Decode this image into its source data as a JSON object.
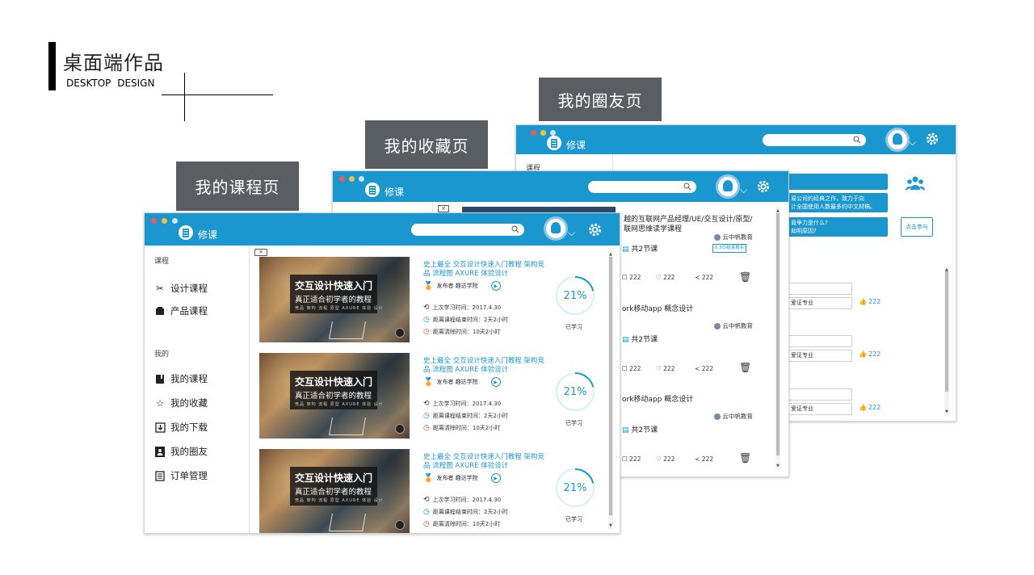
{
  "header": {
    "title": "桌面端作品",
    "subtitle": "DESKTOP  DESIGN"
  },
  "labels": {
    "circle": "我的圈友页",
    "fav": "我的收藏页",
    "course": "我的课程页"
  },
  "app": {
    "brand": "修课"
  },
  "sidebar": {
    "section_course": "课程",
    "items_course": [
      {
        "label": "设计课程",
        "icon": "scissors-icon"
      },
      {
        "label": "产品课程",
        "icon": "box-icon"
      }
    ],
    "section_mine": "我的",
    "items_mine": [
      {
        "label": "我的课程",
        "icon": "book-icon"
      },
      {
        "label": "我的收藏",
        "icon": "star-icon"
      },
      {
        "label": "我的下载",
        "icon": "download-icon"
      },
      {
        "label": "我的圈友",
        "icon": "contact-icon"
      },
      {
        "label": "订单管理",
        "icon": "order-icon"
      }
    ]
  },
  "courses": [
    {
      "title": "史上最全 交互设计快速入门教程 架构竞品 流程图 AXURE 体验设计",
      "publisher": "发布者 趣达学院",
      "last_study": "上次学习时间：2017.4.30",
      "end_time": "距离课程结束时间：2天2小时",
      "clear_time": "距离清除时间：10天2小时",
      "percent": "21%",
      "progress": 0.21,
      "learned": "已学习",
      "img_t1": "交互设计快速入门",
      "img_t2": "真正适合初学者的教程",
      "img_t3": "竞品 架构 流程 原型 AXURE 体验 设计"
    },
    {
      "title": "史上最全 交互设计快速入门教程 架构竞品 流程图 AXURE 体验设计",
      "publisher": "发布者 趣达学院",
      "last_study": "上次学习时间：2017.4.30",
      "end_time": "距离课程结束时间：2天2小时",
      "clear_time": "距离清除时间：10天2小时",
      "percent": "21%",
      "progress": 0.21,
      "learned": "已学习",
      "img_t1": "交互设计快速入门",
      "img_t2": "真正适合初学者的教程",
      "img_t3": "竞品 架构 流程 原型 AXURE 体验 设计"
    },
    {
      "title": "史上最全 交互设计快速入门教程 架构竞品 流程图 AXURE 体验设计",
      "publisher": "发布者 趣达学院",
      "last_study": "上次学习时间：2017.4.30",
      "end_time": "距离课程结束时间：2天2小时",
      "clear_time": "距离清除时间：10天2小时",
      "percent": "21%",
      "progress": 0.21,
      "learned": "已学习",
      "img_t1": "交互设计快速入门",
      "img_t2": "真正适合初学者的教程",
      "img_t3": "竞品 架构 流程 原型 AXURE 体验 设计"
    }
  ],
  "fav": {
    "item1_title_a": "越的互联网产品经理/UE/交互设计/原型/",
    "item1_title_b": "联网思维读学课程",
    "publisher": "云中帆教育",
    "lessons1": "共2节课",
    "tag": "5.3日结束报名",
    "count": "222",
    "item2_title": "ork移动app 概念设计",
    "lessons2": "共2节课",
    "item3_title": "ork移动app 概念设计",
    "lessons3": "共2节课"
  },
  "circle": {
    "side_label": "课程",
    "post1_a": "易公司约经典之作，致力于向",
    "post1_b": "计全国使用人数最多约中文材稿。",
    "post2_a": "竟争力是什么?",
    "post2_b": "劫明原因?",
    "join_label": "点击参与",
    "answer_tag": "爱证专业",
    "likes": "222"
  },
  "colors": {
    "primary": "#1b97d0",
    "label_bg": "#5a5d62"
  }
}
